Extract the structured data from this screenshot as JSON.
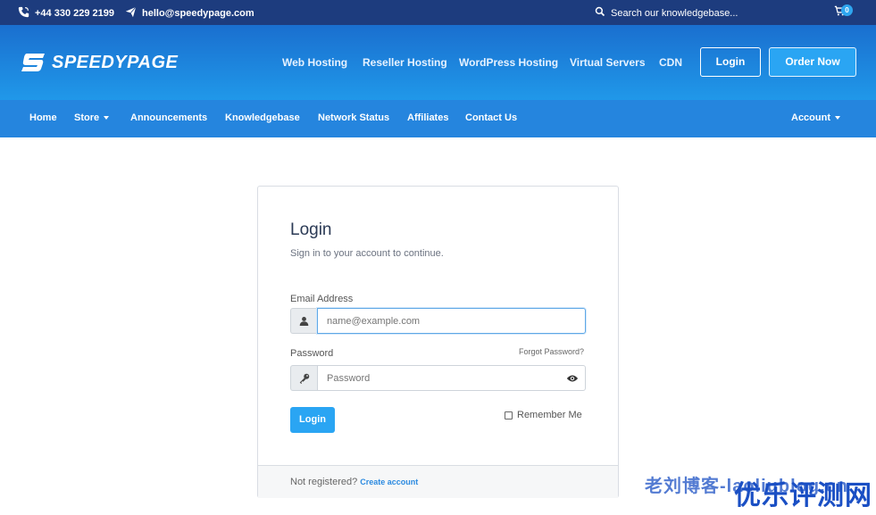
{
  "topbar": {
    "phone": "+44 330 229 2199",
    "email": "hello@speedypage.com",
    "search": "Search our knowledgebase...",
    "cart_count": "0"
  },
  "header": {
    "logo_text": "SPEEDYPAGE",
    "nav": [
      "Web Hosting",
      "Reseller Hosting",
      "WordPress Hosting",
      "Virtual Servers",
      "CDN"
    ],
    "login_label": "Login",
    "order_label": "Order Now"
  },
  "subnav": {
    "items": [
      "Home",
      "Store",
      "Announcements",
      "Knowledgebase",
      "Network Status",
      "Affiliates",
      "Contact Us"
    ],
    "account": "Account"
  },
  "login": {
    "title": "Login",
    "subtitle": "Sign in to your account to continue.",
    "email_label": "Email Address",
    "email_placeholder": "name@example.com",
    "password_label": "Password",
    "forgot": "Forgot Password?",
    "password_placeholder": "Password",
    "submit": "Login",
    "remember": "Remember Me",
    "footer_text": "Not registered?",
    "footer_link": "Create account"
  },
  "watermark": {
    "line1": "老刘博客-laoliublog.cn",
    "line2": "优乐评测网"
  },
  "colors": {
    "topbar": "#1d3c7e",
    "header": "#2098e9",
    "subnav": "#2585de",
    "accent": "#2aa5f3"
  }
}
